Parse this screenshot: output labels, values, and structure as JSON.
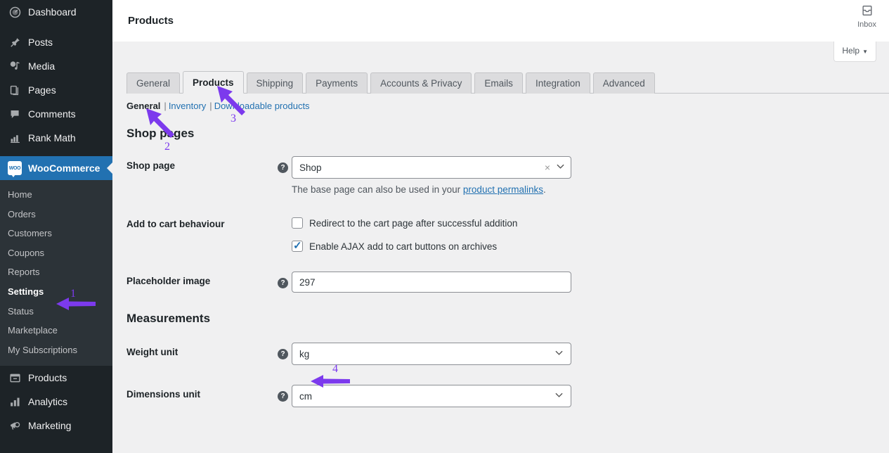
{
  "sidebar": {
    "items": [
      {
        "label": "Dashboard",
        "icon": "dashboard-icon"
      },
      {
        "label": "Posts",
        "icon": "pin-icon"
      },
      {
        "label": "Media",
        "icon": "media-icon"
      },
      {
        "label": "Pages",
        "icon": "pages-icon"
      },
      {
        "label": "Comments",
        "icon": "comments-icon"
      },
      {
        "label": "Rank Math",
        "icon": "rankmath-icon"
      },
      {
        "label": "WooCommerce",
        "icon": "woocommerce-logo-icon"
      },
      {
        "label": "Products",
        "icon": "products-icon"
      },
      {
        "label": "Analytics",
        "icon": "analytics-icon"
      },
      {
        "label": "Marketing",
        "icon": "marketing-icon"
      }
    ],
    "woo_submenu": [
      {
        "label": "Home"
      },
      {
        "label": "Orders"
      },
      {
        "label": "Customers"
      },
      {
        "label": "Coupons"
      },
      {
        "label": "Reports"
      },
      {
        "label": "Settings"
      },
      {
        "label": "Status"
      },
      {
        "label": "Marketplace"
      },
      {
        "label": "My Subscriptions"
      }
    ],
    "current_item": "WooCommerce",
    "current_submenu": "Settings",
    "woo_logo_text": "WOO",
    "highlight_color": "#2271b1"
  },
  "header": {
    "title": "Products",
    "inbox_label": "Inbox",
    "help_label": "Help",
    "help_caret": "▼"
  },
  "tabs": [
    {
      "label": "General",
      "active": false
    },
    {
      "label": "Products",
      "active": true
    },
    {
      "label": "Shipping",
      "active": false
    },
    {
      "label": "Payments",
      "active": false
    },
    {
      "label": "Accounts & Privacy",
      "active": false
    },
    {
      "label": "Emails",
      "active": false
    },
    {
      "label": "Integration",
      "active": false
    },
    {
      "label": "Advanced",
      "active": false
    }
  ],
  "subnav": {
    "items": [
      {
        "label": "General",
        "current": true
      },
      {
        "label": "Inventory",
        "current": false
      },
      {
        "label": "Downloadable products",
        "current": false
      }
    ],
    "separator": "|"
  },
  "sections": {
    "shop_pages": {
      "heading": "Shop pages",
      "shop_page": {
        "label": "Shop page",
        "value": "Shop",
        "clear_glyph": "×",
        "caret_glyph": "⌄",
        "help_glyph": "?",
        "description_before": "The base page can also be used in your ",
        "description_link": "product permalinks",
        "description_after": "."
      },
      "add_to_cart": {
        "label": "Add to cart behaviour",
        "options": [
          {
            "label": "Redirect to the cart page after successful addition",
            "checked": false
          },
          {
            "label": "Enable AJAX add to cart buttons on archives",
            "checked": true
          }
        ]
      },
      "placeholder_image": {
        "label": "Placeholder image",
        "value": "297",
        "help_glyph": "?"
      }
    },
    "measurements": {
      "heading": "Measurements",
      "weight_unit": {
        "label": "Weight unit",
        "value": "kg",
        "help_glyph": "?",
        "caret_glyph": "⌄"
      },
      "dimensions_unit": {
        "label": "Dimensions unit",
        "value": "cm",
        "help_glyph": "?",
        "caret_glyph": "⌄"
      }
    }
  },
  "annotations": {
    "color": "#7c3aed",
    "markers": [
      {
        "number": "1",
        "target": "Settings"
      },
      {
        "number": "2",
        "target": "General subnav"
      },
      {
        "number": "3",
        "target": "Products tab"
      },
      {
        "number": "4",
        "target": "Weight unit kg"
      }
    ]
  }
}
